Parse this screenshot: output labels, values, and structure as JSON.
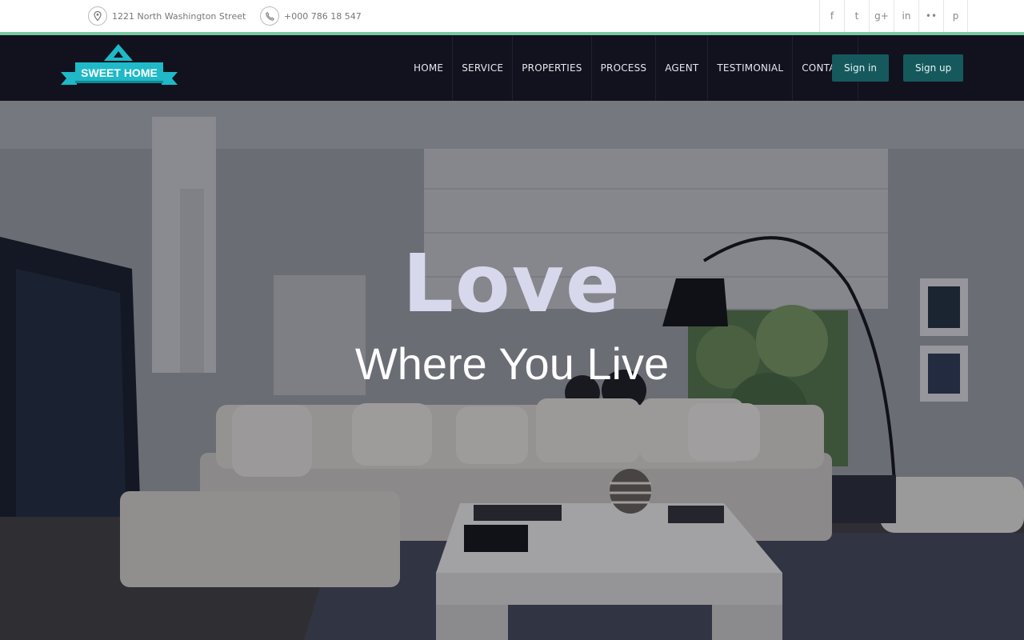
{
  "topbar": {
    "address": "1221 North Washington Street",
    "phone": "+000 786 18 547",
    "social": [
      {
        "icon": "facebook-icon",
        "glyph": "f"
      },
      {
        "icon": "twitter-icon",
        "glyph": "t"
      },
      {
        "icon": "google-plus-icon",
        "glyph": "g+"
      },
      {
        "icon": "linkedin-icon",
        "glyph": "in"
      },
      {
        "icon": "flickr-icon",
        "glyph": "••"
      },
      {
        "icon": "pinterest-icon",
        "glyph": "p"
      }
    ]
  },
  "brand": {
    "logo_text": "SWEET HOME",
    "accent_color": "#76c9a0",
    "logo_color": "#1fb9c8"
  },
  "nav": {
    "items": [
      "HOME",
      "SERVICE",
      "PROPERTIES",
      "PROCESS",
      "AGENT",
      "TESTIMONIAL",
      "CONTACT"
    ],
    "signin": "Sign in",
    "signup": "Sign up",
    "button_color": "#15595d",
    "background": "#12121f"
  },
  "hero": {
    "title": "Love",
    "subtitle": "Where You Live"
  }
}
